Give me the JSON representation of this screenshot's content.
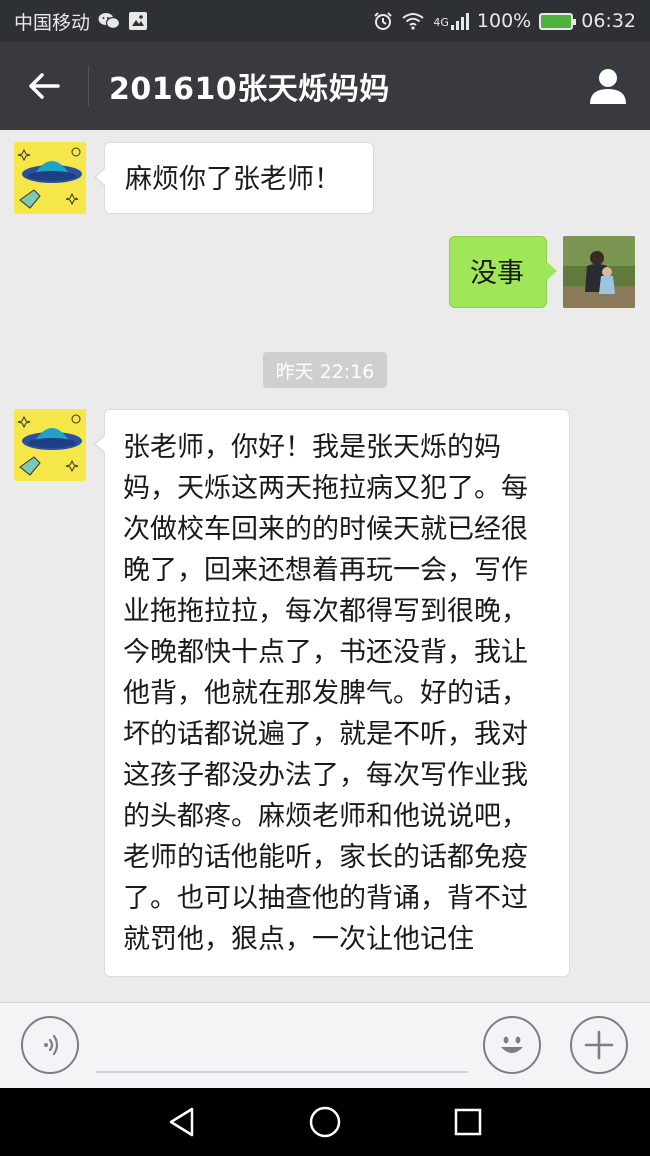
{
  "status_bar": {
    "carrier": "中国移动",
    "network": "4G",
    "battery": "100%",
    "time": "06:32"
  },
  "title_bar": {
    "title": "201610张天烁妈妈"
  },
  "messages": [
    {
      "side": "left",
      "text": "麻烦你了张老师！"
    },
    {
      "side": "right",
      "text": "没事"
    },
    {
      "side": "left",
      "text": "张老师，你好！我是张天烁的妈妈，天烁这两天拖拉病又犯了。每次做校车回来的的时候天就已经很晚了，回来还想着再玩一会，写作业拖拖拉拉，每次都得写到很晚，今晚都快十点了，书还没背，我让他背，他就在那发脾气。好的话，坏的话都说遍了，就是不听，我对这孩子都没办法了，每次写作业我的头都疼。麻烦老师和他说说吧，老师的话他能听，家长的话都免疫了。也可以抽查他的背诵，背不过就罚他，狠点，一次让他记住"
    }
  ],
  "timestamp": "昨天 22:16",
  "icons": {
    "back": "back-arrow-icon",
    "profile": "person-icon",
    "voice": "voice-icon",
    "emoji": "emoji-icon",
    "more": "plus-icon",
    "nav_back": "nav-back-icon",
    "nav_home": "nav-home-icon",
    "nav_recent": "nav-recent-icon"
  },
  "colors": {
    "title_bar": "#393a3f",
    "status_bar": "#2d3034",
    "chat_bg": "#ebebeb",
    "sent_bubble": "#9fe658",
    "received_bubble": "#ffffff"
  }
}
